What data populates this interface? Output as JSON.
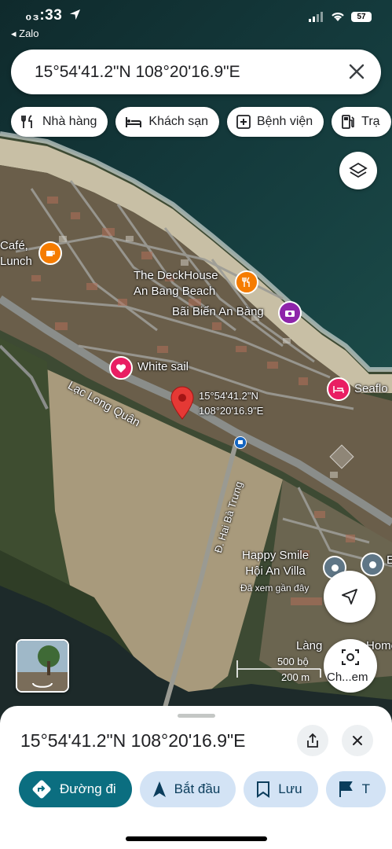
{
  "status_bar": {
    "time": "₀₃:33",
    "back_app": "◂ Zalo",
    "battery": "57"
  },
  "search": {
    "value": "15°54'41.2\"N 108°20'16.9\"E"
  },
  "chips": [
    {
      "label": "Nhà hàng",
      "icon": "fork-knife-icon"
    },
    {
      "label": "Khách sạn",
      "icon": "bed-icon"
    },
    {
      "label": "Bệnh viện",
      "icon": "hospital-icon"
    },
    {
      "label": "Trạ",
      "icon": "gas-station-icon"
    }
  ],
  "map": {
    "labels": {
      "cafe": "Café,\nLunch",
      "deckhouse": "The DeckHouse\nAn Bang Beach",
      "bai_bien": "Bãi Biển An Bàng",
      "white_sail": "White sail",
      "seaflo": "Seaflo",
      "pin_coord": "15°54'41.2\"N\n108°20'16.9\"E",
      "road_lac_long_quan": "Lạc Long Quân",
      "road_hai_ba_trung": "Đ. Hai Bà Trưng",
      "happy_smile": "Happy Smile\nHội An Villa",
      "happy_smile_sub": "Đã xem gần đây",
      "lang_home": "Làng",
      "lang_home2": "Home",
      "e_label": "E"
    },
    "scale": {
      "top": "500 bộ",
      "bottom": "200 m"
    },
    "lens_label": "Ch...em"
  },
  "sheet": {
    "title": "15°54'41.2\"N 108°20'16.9\"E",
    "actions": [
      {
        "label": "Đường đi",
        "icon": "directions-icon"
      },
      {
        "label": "Bắt đầu",
        "icon": "navigation-arrow-icon"
      },
      {
        "label": "Lưu",
        "icon": "bookmark-icon"
      },
      {
        "label": "T",
        "icon": "flag-icon"
      }
    ]
  },
  "colors": {
    "accent": "#0b6e80",
    "chip_blue": "#d3e3f5",
    "pin_red": "#e53935",
    "restaurant_orange": "#f57c00",
    "hotel_pink": "#e91e63",
    "attraction_purple": "#8e24aa"
  }
}
